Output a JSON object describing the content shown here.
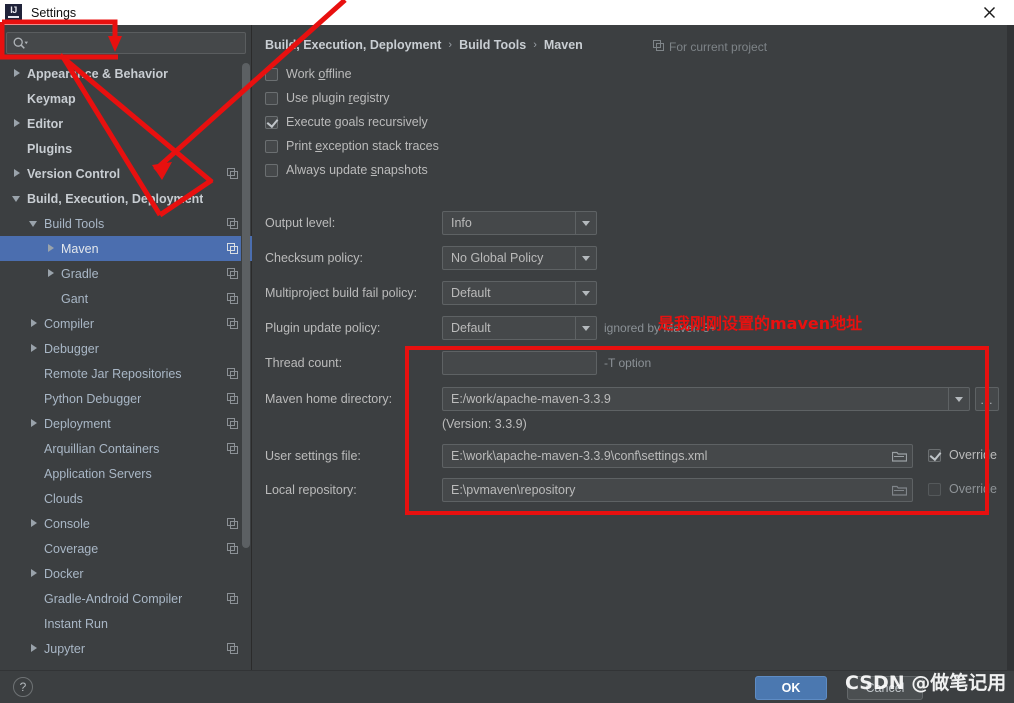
{
  "window": {
    "title": "Settings",
    "logo_text": "IJ",
    "logo_icon": "intellij-idea-logo",
    "close_icon": "close-icon"
  },
  "search": {
    "value": "",
    "placeholder": "",
    "icon": "search-icon"
  },
  "sidebar": {
    "items": [
      {
        "label": "Appearance & Behavior",
        "arrow": "right",
        "indent": 0,
        "bold": true,
        "copy": false,
        "selected": false
      },
      {
        "label": "Keymap",
        "arrow": "none",
        "indent": 0,
        "bold": true,
        "copy": false,
        "selected": false
      },
      {
        "label": "Editor",
        "arrow": "right",
        "indent": 0,
        "bold": true,
        "copy": false,
        "selected": false
      },
      {
        "label": "Plugins",
        "arrow": "none",
        "indent": 0,
        "bold": true,
        "copy": false,
        "selected": false
      },
      {
        "label": "Version Control",
        "arrow": "right",
        "indent": 0,
        "bold": true,
        "copy": true,
        "selected": false
      },
      {
        "label": "Build, Execution, Deployment",
        "arrow": "down",
        "indent": 0,
        "bold": true,
        "copy": false,
        "selected": false
      },
      {
        "label": "Build Tools",
        "arrow": "down",
        "indent": 1,
        "bold": false,
        "copy": true,
        "selected": false
      },
      {
        "label": "Maven",
        "arrow": "right",
        "indent": 2,
        "bold": false,
        "copy": true,
        "selected": true
      },
      {
        "label": "Gradle",
        "arrow": "right",
        "indent": 2,
        "bold": false,
        "copy": true,
        "selected": false
      },
      {
        "label": "Gant",
        "arrow": "none",
        "indent": 2,
        "bold": false,
        "copy": true,
        "selected": false
      },
      {
        "label": "Compiler",
        "arrow": "right",
        "indent": 1,
        "bold": false,
        "copy": true,
        "selected": false
      },
      {
        "label": "Debugger",
        "arrow": "right",
        "indent": 1,
        "bold": false,
        "copy": false,
        "selected": false
      },
      {
        "label": "Remote Jar Repositories",
        "arrow": "none",
        "indent": 1,
        "bold": false,
        "copy": true,
        "selected": false
      },
      {
        "label": "Python Debugger",
        "arrow": "none",
        "indent": 1,
        "bold": false,
        "copy": true,
        "selected": false
      },
      {
        "label": "Deployment",
        "arrow": "right",
        "indent": 1,
        "bold": false,
        "copy": true,
        "selected": false
      },
      {
        "label": "Arquillian Containers",
        "arrow": "none",
        "indent": 1,
        "bold": false,
        "copy": true,
        "selected": false
      },
      {
        "label": "Application Servers",
        "arrow": "none",
        "indent": 1,
        "bold": false,
        "copy": false,
        "selected": false
      },
      {
        "label": "Clouds",
        "arrow": "none",
        "indent": 1,
        "bold": false,
        "copy": false,
        "selected": false
      },
      {
        "label": "Console",
        "arrow": "right",
        "indent": 1,
        "bold": false,
        "copy": true,
        "selected": false
      },
      {
        "label": "Coverage",
        "arrow": "none",
        "indent": 1,
        "bold": false,
        "copy": true,
        "selected": false
      },
      {
        "label": "Docker",
        "arrow": "right",
        "indent": 1,
        "bold": false,
        "copy": false,
        "selected": false
      },
      {
        "label": "Gradle-Android Compiler",
        "arrow": "none",
        "indent": 1,
        "bold": false,
        "copy": true,
        "selected": false
      },
      {
        "label": "Instant Run",
        "arrow": "none",
        "indent": 1,
        "bold": false,
        "copy": false,
        "selected": false
      },
      {
        "label": "Jupyter",
        "arrow": "right",
        "indent": 1,
        "bold": false,
        "copy": true,
        "selected": false
      }
    ]
  },
  "content": {
    "breadcrumb": [
      "Build, Execution, Deployment",
      "Build Tools",
      "Maven"
    ],
    "breadcrumb_separator": "›",
    "for_current_project": "For current project",
    "checkboxes": [
      {
        "pre": "Work ",
        "mn": "o",
        "post": "ffline",
        "checked": false
      },
      {
        "pre": "Use plugin ",
        "mn": "r",
        "post": "egistry",
        "checked": false
      },
      {
        "pre": "Execute ",
        "mn": "g",
        "post": "oals recursively",
        "checked": true
      },
      {
        "pre": "Print ",
        "mn": "e",
        "post": "xception stack traces",
        "checked": false
      },
      {
        "pre": "Always update ",
        "mn": "s",
        "post": "napshots",
        "checked": false
      }
    ],
    "output_level": {
      "label": "Output level:",
      "value": "Info"
    },
    "checksum_policy": {
      "label": "Checksum policy:",
      "value": "No Global Policy"
    },
    "multiproject_policy": {
      "label": "Multiproject build fail policy:",
      "value": "Default"
    },
    "plugin_update_policy": {
      "label": "Plugin update policy:",
      "value": "Default",
      "hint": "ignored by Maven 3+"
    },
    "thread_count": {
      "label": "Thread count:",
      "value": "",
      "hint": "-T option"
    },
    "maven_home": {
      "label": "Maven home directory:",
      "value": "E:/work/apache-maven-3.3.9",
      "browse_label": "..."
    },
    "version_note": "(Version: 3.3.9)",
    "user_settings": {
      "label": "User settings file:",
      "value": "E:\\work\\apache-maven-3.3.9\\conf\\settings.xml",
      "override_label": "Override",
      "override_checked": true
    },
    "local_repository": {
      "label": "Local repository:",
      "value": "E:\\pvmaven\\repository",
      "override_label": "Override",
      "override_checked": false
    }
  },
  "footer": {
    "help_label": "?",
    "ok_label": "OK",
    "cancel_label": "Cancel"
  },
  "annotations": {
    "note_text": "是我刚刚设置的maven地址",
    "note_color": "#e8100f",
    "box_color": "#e8100f",
    "watermark": "CSDN @做笔记用"
  }
}
